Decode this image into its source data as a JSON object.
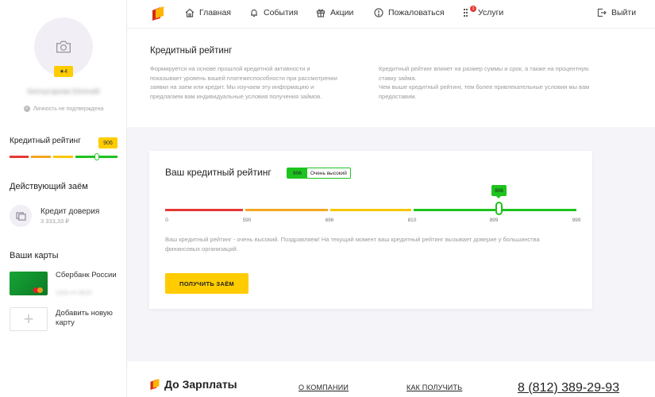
{
  "header": {
    "nav": [
      {
        "label": "Главная",
        "icon": "home-icon"
      },
      {
        "label": "События",
        "icon": "bell-icon"
      },
      {
        "label": "Акции",
        "icon": "gift-icon"
      },
      {
        "label": "Пожаловаться",
        "icon": "exclamation-icon"
      },
      {
        "label": "Услуги",
        "icon": "services-icon",
        "badge": "1"
      }
    ],
    "logout_label": "Выйти"
  },
  "sidebar": {
    "avatar_icon": "camera-icon",
    "level_badge": "★4",
    "user_name": "Белоусарова Евгений",
    "identity_status": "Личность не подтверждена",
    "rating_label": "Кредитный рейтинг",
    "rating_value": "906",
    "rating_fraction": 0.906,
    "loan_section_title": "Действующий заём",
    "loan_name": "Кредит доверия",
    "loan_amount": "3 333,33 ₽",
    "cards_section_title": "Ваши карты",
    "card_bank": "Сбербанк России",
    "card_number": "1234 •••• 5678",
    "add_card_label": "Добавить новую карту"
  },
  "info": {
    "title": "Кредитный рейтинг",
    "left_text": "Формируется на основе прошлой кредитной активности и показывает уровень вашей платежеспособности при рассмотрении заявки на заем или кредит. Мы изучаем эту информацию и предлагаем вам индивидуальные условия получения займов.",
    "right_text_1": "Кредитный рейтинг влияет на размер суммы и срок, а также на процентную ставку займа.",
    "right_text_2": "Чем выше кредитный рейтинг, тем более привлекательные условия мы вам предоставим."
  },
  "rating_card": {
    "title": "Ваш кредитный рейтинг",
    "value": "906",
    "level": "Очень высокий",
    "scale_ticks": [
      "0",
      "590",
      "696",
      "810",
      "899",
      "999"
    ],
    "description": "Ваш кредитный рейтинг - очень высокий. Поздравляем! На текущий момент ваш кредитный рейтинг вызывает доверие у большинства финансовых организаций.",
    "button_label": "ПОЛУЧИТЬ ЗАЁМ",
    "colors": {
      "red": "#e53935",
      "orange": "#f5a623",
      "yellow": "#f7c600",
      "green": "#1ec31e"
    }
  },
  "footer": {
    "brand": "До Зарплаты",
    "about_link": "О КОМПАНИИ",
    "how_link": "КАК ПОЛУЧИТЬ",
    "phone": "8 (812) 389-29-93"
  }
}
